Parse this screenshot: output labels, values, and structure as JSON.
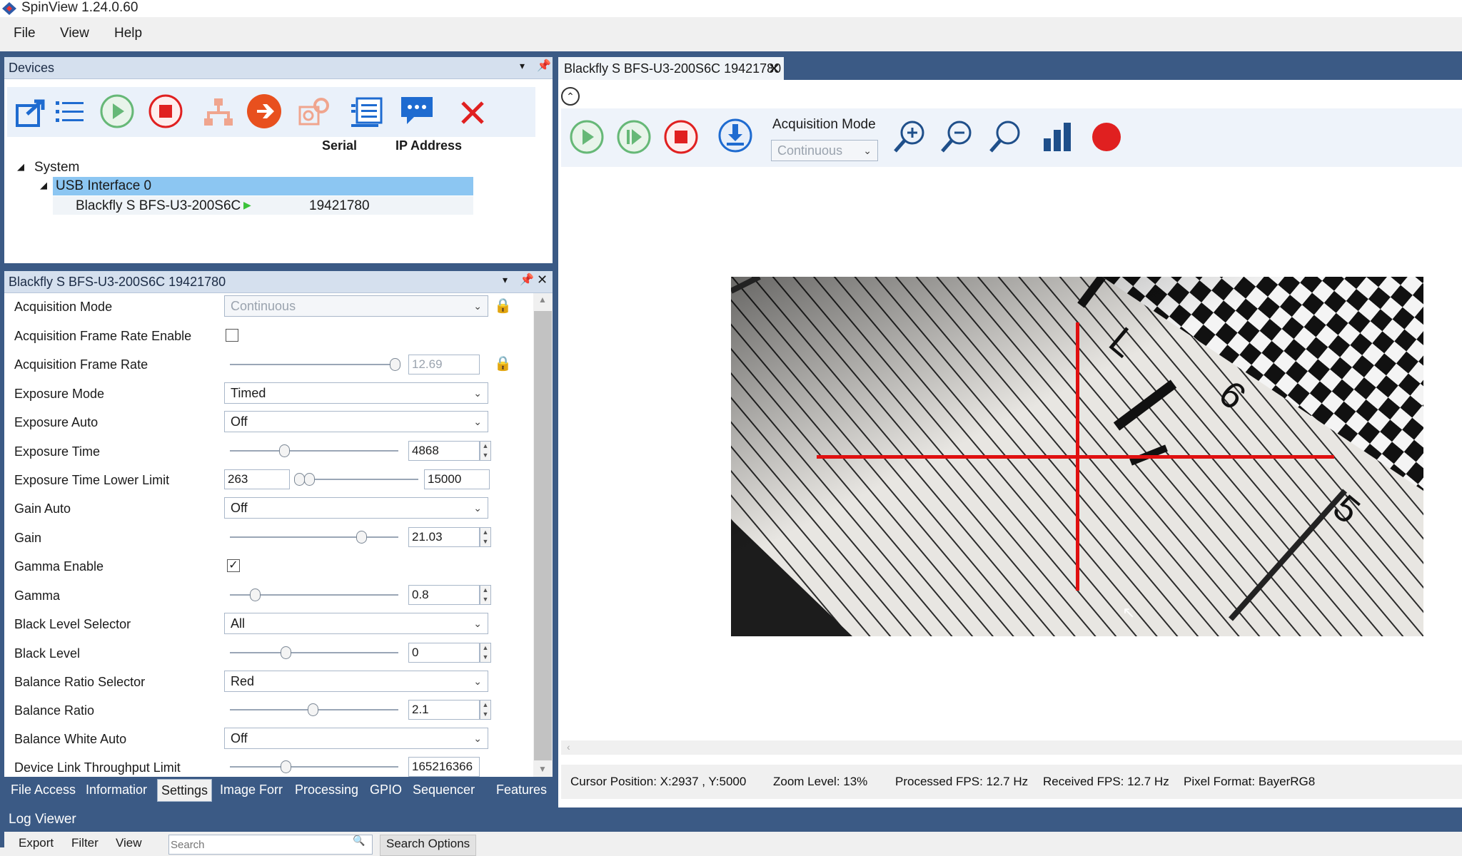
{
  "app": {
    "title": "SpinView 1.24.0.60"
  },
  "menu": [
    "File",
    "View",
    "Help"
  ],
  "devices_panel": {
    "title": "Devices",
    "columns": {
      "serial": "Serial",
      "ip": "IP Address"
    },
    "tree": {
      "system": "System",
      "interface": "USB Interface 0",
      "camera": "Blackfly S BFS-U3-200S6C",
      "serial": "19421780"
    }
  },
  "props_panel": {
    "title": "Blackfly S BFS-U3-200S6C 19421780",
    "rows": [
      {
        "label": "Acquisition Mode",
        "value": "Continuous"
      },
      {
        "label": "Acquisition Frame Rate Enable"
      },
      {
        "label": "Acquisition Frame Rate",
        "value": "12.69",
        "slider": 0.98
      },
      {
        "label": "Exposure Mode",
        "value": "Timed"
      },
      {
        "label": "Exposure Auto",
        "value": "Off"
      },
      {
        "label": "Exposure Time",
        "value": "4868",
        "slider": 0.32
      },
      {
        "label": "Exposure Time Lower Limit",
        "min": "263",
        "max": "15000",
        "slider": 0.05
      },
      {
        "label": "Gain Auto",
        "value": "Off"
      },
      {
        "label": "Gain",
        "value": "21.03",
        "slider": 0.78
      },
      {
        "label": "Gamma Enable",
        "checked": true
      },
      {
        "label": "Gamma",
        "value": "0.8",
        "slider": 0.15
      },
      {
        "label": "Black Level Selector",
        "value": "All"
      },
      {
        "label": "Black Level",
        "value": "0",
        "slider": 0.33
      },
      {
        "label": "Balance Ratio Selector",
        "value": "Red"
      },
      {
        "label": "Balance Ratio",
        "value": "2.1",
        "slider": 0.49
      },
      {
        "label": "Balance White Auto",
        "value": "Off"
      },
      {
        "label": "Device Link Throughput Limit",
        "value": "165216366",
        "slider": 0.33
      }
    ]
  },
  "bottom_tabs": [
    "File Access",
    "Informatior",
    "Settings",
    "Image Forr",
    "Processing",
    "GPIO",
    "Sequencer",
    "Features"
  ],
  "log_viewer": {
    "title": "Log Viewer",
    "menu": [
      "Export",
      "Filter",
      "View"
    ],
    "search_placeholder": "Search",
    "search_options": "Search Options"
  },
  "image_panel": {
    "tab_title": "Blackfly S BFS-U3-200S6C 19421780",
    "acq_mode_label": "Acquisition Mode",
    "acq_mode_value": "Continuous",
    "image_labels": {
      "l": "L",
      "six": "6",
      "five": "5"
    }
  },
  "status": {
    "cursor": "Cursor Position: X:2937 , Y:5000",
    "zoom": "Zoom Level: 13%",
    "processed_fps": "Processed FPS: 12.7 Hz",
    "received_fps": "Received FPS: 12.7 Hz",
    "pixel_format": "Pixel Format: BayerRG8"
  },
  "colors": {
    "accent": "#3b5a85",
    "selection": "#8cc6f2",
    "record": "#e02020"
  }
}
